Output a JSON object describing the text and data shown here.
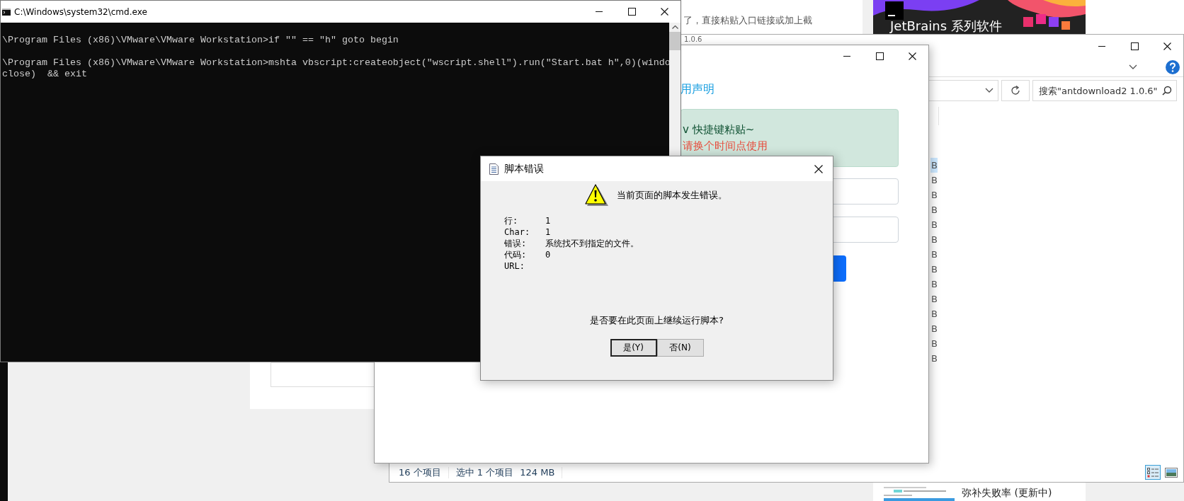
{
  "background_page": {
    "text": "了，直接粘贴入口链接或加上截"
  },
  "banner": {
    "heading": "JetBrains 系列软件"
  },
  "article_card": {
    "title": "弥补失败率 (更新中)"
  },
  "explorer": {
    "title": "1.0.6",
    "search": {
      "placeholder": "搜索\"antdownload2 1.0.6\""
    },
    "rows": [
      {
        "size": "B",
        "selected": true
      },
      {
        "size": "B",
        "selected": false
      },
      {
        "size": "B",
        "selected": false
      },
      {
        "size": "B",
        "selected": false
      },
      {
        "size": "B",
        "selected": false
      },
      {
        "size": "B",
        "selected": false
      },
      {
        "size": "B",
        "selected": false
      },
      {
        "size": "B",
        "selected": false
      },
      {
        "size": "B",
        "selected": false
      },
      {
        "size": "B",
        "selected": false
      },
      {
        "size": "B",
        "selected": false
      },
      {
        "size": "B",
        "selected": false
      },
      {
        "size": "B",
        "selected": false
      },
      {
        "size": "B",
        "selected": false
      }
    ],
    "status_bar": {
      "count": "16 个项目",
      "selection": "选中 1 个项目",
      "size": "124 MB"
    }
  },
  "app_window": {
    "link": "用声明",
    "notice": {
      "line_1": "v 快捷键粘贴~",
      "line_2": "请换个时间点使用"
    },
    "fields": [
      {
        "kind": "input"
      },
      {
        "kind": "input"
      }
    ],
    "button": {
      "kind": "primary"
    }
  },
  "cmd_window": {
    "title": "C:\\Windows\\system32\\cmd.exe",
    "lines": [
      {
        "text": "\\Program Files (x86)\\VMware\\VMware Workstation>if \"\" == \"h\" goto begin",
        "blank_before": false
      },
      {
        "text": "\\Program Files (x86)\\VMware\\VMware Workstation>mshta vbscript:createobject(\"wscript.shell\").run(\"Start.bat h\",0)(windo",
        "blank_before": true
      },
      {
        "text": "close)  && exit",
        "blank_before": false
      }
    ]
  },
  "dialog": {
    "title": "脚本错误",
    "message": "当前页面的脚本发生错误。",
    "details": [
      {
        "label": "行:",
        "value": "1"
      },
      {
        "label": "Char:",
        "value": "1"
      },
      {
        "label": "错误:",
        "value": "系统找不到指定的文件。"
      },
      {
        "label": "代码:",
        "value": "0"
      },
      {
        "label": "URL:"
      }
    ],
    "question": "是否要在此页面上继续运行脚本?",
    "buttons": [
      {
        "label": "是(Y)",
        "default": true
      },
      {
        "label": "否(N)",
        "default": false
      }
    ]
  }
}
